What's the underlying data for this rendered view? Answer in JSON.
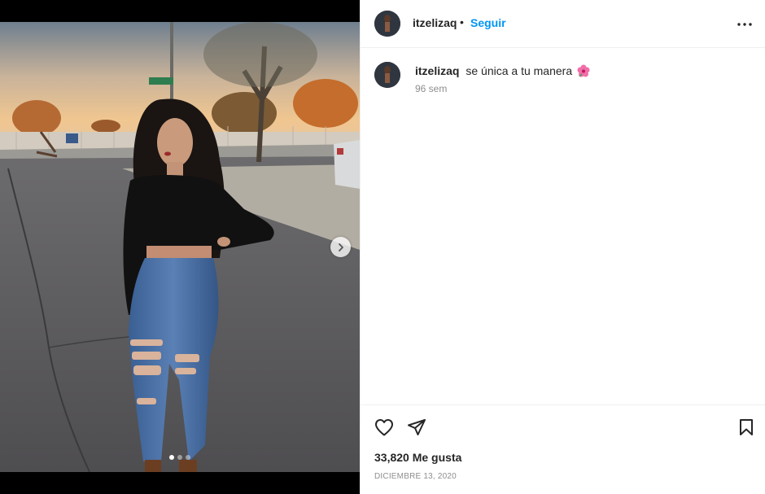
{
  "post": {
    "username": "itzelizaq",
    "bullet": "•",
    "follow_label": "Seguir",
    "more_icon": "more-options-icon",
    "caption": "se única a tu manera",
    "caption_emoji": "hibiscus-flower",
    "comment_age": "96 sem",
    "likes": "33,820 Me gusta",
    "date": "DICIEMBRE 13, 2020"
  },
  "media": {
    "carousel_total": 3,
    "carousel_active": 1,
    "next_icon": "chevron-right-icon"
  },
  "icons": {
    "like": "heart-icon",
    "share": "paper-plane-icon",
    "save": "bookmark-icon"
  },
  "colors": {
    "accent": "#0095f6",
    "text": "#262626",
    "muted": "#8e8e8e",
    "border": "#efefef"
  }
}
